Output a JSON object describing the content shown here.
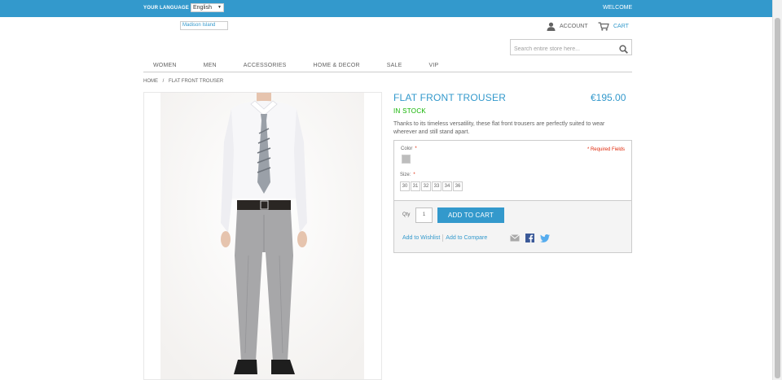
{
  "topbar": {
    "language_label": "YOUR LANGUAGE",
    "language_value": "English",
    "welcome": "WELCOME"
  },
  "header": {
    "logo_alt": "Madison Island",
    "account_label": "ACCOUNT",
    "cart_label": "CART",
    "search_placeholder": "Search entire store here..."
  },
  "nav": {
    "items": [
      "WOMEN",
      "MEN",
      "ACCESSORIES",
      "HOME & DECOR",
      "SALE",
      "VIP"
    ]
  },
  "breadcrumb": {
    "home": "HOME",
    "separator": "/",
    "current": "FLAT FRONT TROUSER"
  },
  "product": {
    "title": "FLAT FRONT TROUSER",
    "price": "€195.00",
    "availability": "IN STOCK",
    "description": "Thanks to its timeless versatility, these flat front trousers are perfectly suited to wear wherever and still stand apart.",
    "color_label": "Color",
    "required_mark": "*",
    "required_note": "* Required Fields",
    "size_label": "Size",
    "sizes": [
      "30",
      "31",
      "32",
      "33",
      "34",
      "36"
    ],
    "qty_label": "Qty",
    "qty_value": "1",
    "add_to_cart": "ADD TO CART",
    "wishlist_link": "Add to Wishlist",
    "compare_link": "Add to Compare"
  },
  "colors": {
    "accent": "#3399cc",
    "in_stock": "#11b400",
    "required": "#df280a",
    "facebook": "#3b5998",
    "twitter": "#55acee"
  },
  "icons": [
    "user-icon",
    "cart-icon",
    "search-icon",
    "email-icon",
    "facebook-icon",
    "twitter-icon",
    "chevron-down-icon"
  ]
}
